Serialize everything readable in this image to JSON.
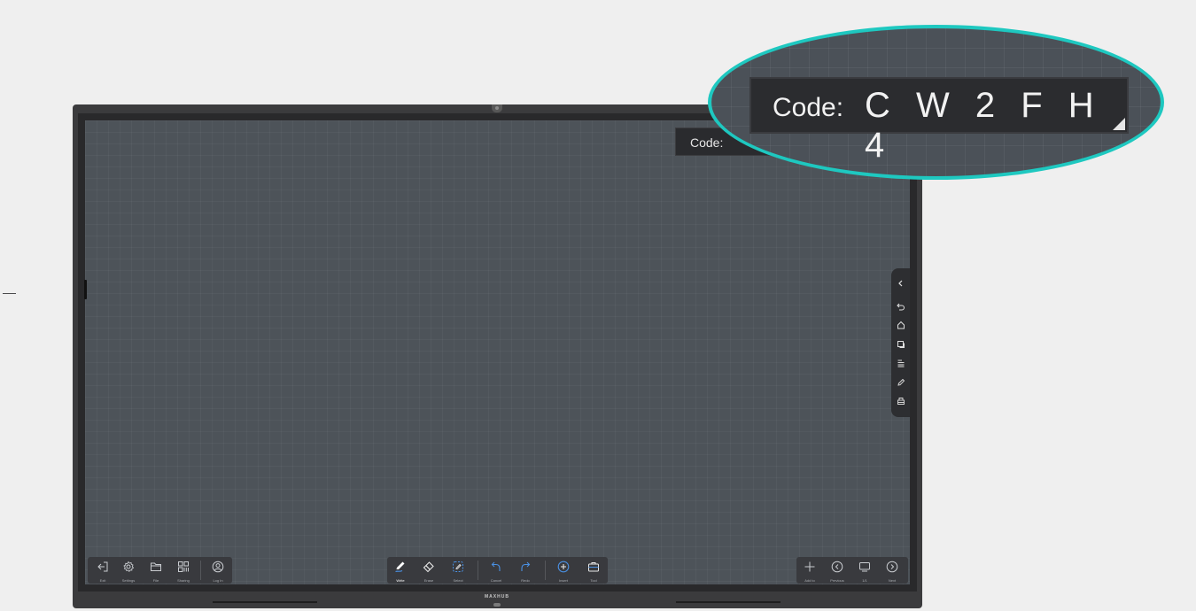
{
  "code_box": {
    "label": "Code:",
    "code": "C W 2 F H 4"
  },
  "left_tools": [
    {
      "label": "Exit",
      "icon": "exit-icon"
    },
    {
      "label": "Settings",
      "icon": "gear-icon"
    },
    {
      "label": "File",
      "icon": "folder-icon"
    },
    {
      "label": "Sharing",
      "icon": "qr-code-icon"
    },
    {
      "label": "Log In",
      "icon": "user-circle-icon"
    }
  ],
  "center_tools": [
    {
      "label": "Write",
      "icon": "pen-icon",
      "active": true
    },
    {
      "label": "Erase",
      "icon": "eraser-icon"
    },
    {
      "label": "Select",
      "icon": "select-icon"
    },
    {
      "label": "Cancel",
      "icon": "undo-icon"
    },
    {
      "label": "Redo",
      "icon": "redo-icon"
    },
    {
      "label": "Insert",
      "icon": "plus-circle-icon"
    },
    {
      "label": "Tool",
      "icon": "toolbox-icon"
    }
  ],
  "right_tools": [
    {
      "label": "Add to",
      "icon": "plus-icon"
    },
    {
      "label": "Previous",
      "icon": "chevron-left-circle-icon"
    },
    {
      "label": "1/1",
      "icon": "pages-icon"
    },
    {
      "label": "Next",
      "icon": "chevron-right-circle-icon"
    }
  ],
  "side_panel": [
    "collapse-icon",
    "back-icon",
    "home-icon",
    "window-icon",
    "menu-icon",
    "annotate-icon",
    "print-icon"
  ],
  "brand": "MAXHUB",
  "colors": {
    "accent": "#1ec8c0",
    "select_blue": "#4a90e2",
    "canvas": "#4d5359",
    "toolbar": "#393a3e"
  }
}
